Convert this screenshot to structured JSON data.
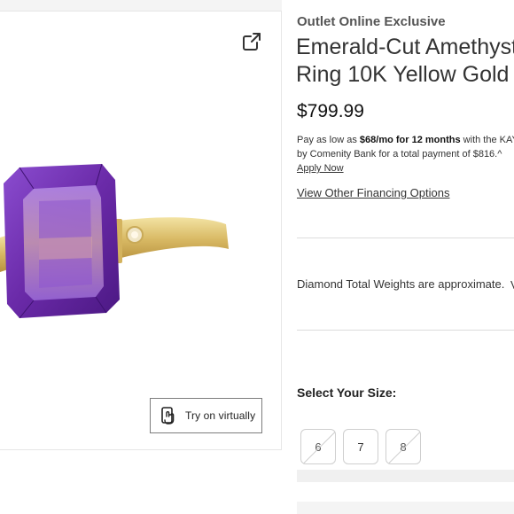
{
  "product": {
    "kicker": "Outlet Online Exclusive",
    "title_line1": "Emerald-Cut Amethyst",
    "title_line2": "Ring 10K Yellow Gold",
    "price": "$799.99"
  },
  "financing": {
    "prefix": "Pay as low as ",
    "monthly": "$68/mo for 12 months",
    "mid1": " with the KAY",
    "mid2": "by Comenity Bank for a total payment of $816.^",
    "apply": "Apply Now",
    "view_options": "View Other Financing Options"
  },
  "diamond_note": "Diamond Total Weights are approximate.",
  "diamond_chevron": "V",
  "sizes": {
    "label": "Select Your Size:",
    "options": [
      "6",
      "7",
      "8"
    ],
    "unavailable": [
      "6",
      "8"
    ]
  },
  "gallery": {
    "try_on": "Try on virtually",
    "icons": [
      "share-icon",
      "virtual-try-on-icon"
    ]
  },
  "colors": {
    "amethyst": "#6a2aa8",
    "gold": "#d8b964"
  }
}
